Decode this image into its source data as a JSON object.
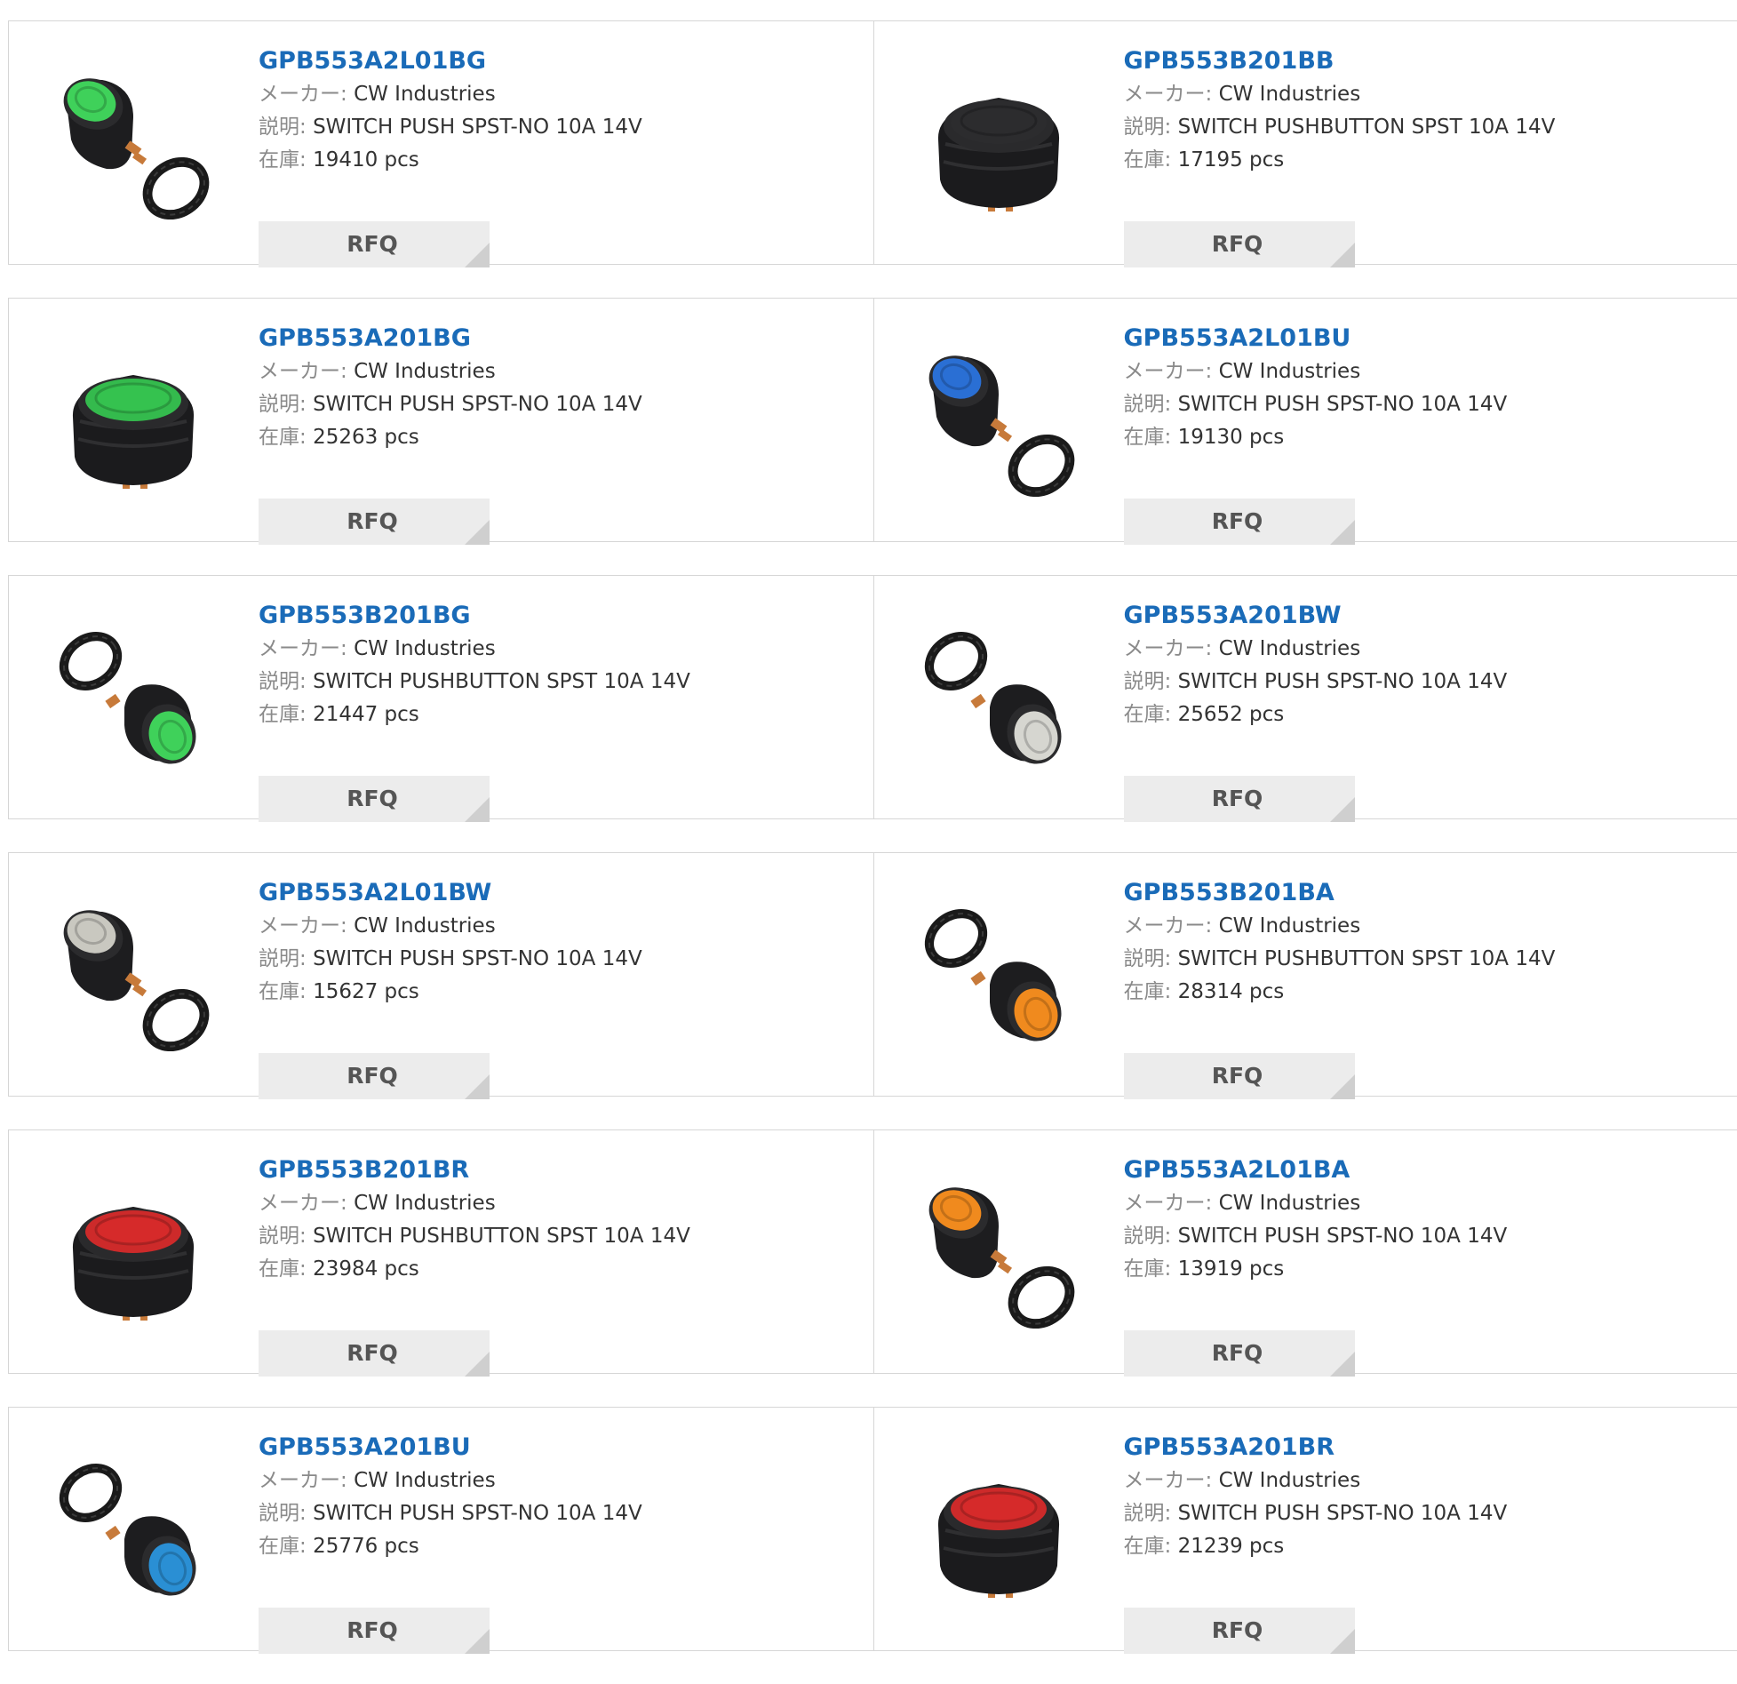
{
  "labels": {
    "maker": "メーカー:",
    "desc": "説明:",
    "stock": "在庫:",
    "rfq": "RFQ"
  },
  "colors": {
    "link": "#1a6bb8",
    "button_bg": "#ececec",
    "border": "#d6d6d6"
  },
  "products": [
    {
      "pn": "GPB553A2L01BG",
      "maker": "CW Industries",
      "desc": "SWITCH PUSH SPST-NO 10A 14V",
      "stock": "19410 pcs",
      "image": {
        "kind": "with-nut",
        "cap": "#3fd15a"
      }
    },
    {
      "pn": "GPB553B201BB",
      "maker": "CW Industries",
      "desc": "SWITCH PUSHBUTTON SPST 10A 14V",
      "stock": "17195 pcs",
      "image": {
        "kind": "large",
        "cap": "#2c2c2e"
      }
    },
    {
      "pn": "GPB553A201BG",
      "maker": "CW Industries",
      "desc": "SWITCH PUSH SPST-NO 10A 14V",
      "stock": "25263 pcs",
      "image": {
        "kind": "large",
        "cap": "#35c24f"
      }
    },
    {
      "pn": "GPB553A2L01BU",
      "maker": "CW Industries",
      "desc": "SWITCH PUSH SPST-NO 10A 14V",
      "stock": "19130 pcs",
      "image": {
        "kind": "with-nut",
        "cap": "#2a6fd4"
      }
    },
    {
      "pn": "GPB553B201BG",
      "maker": "CW Industries",
      "desc": "SWITCH PUSHBUTTON SPST 10A 14V",
      "stock": "21447 pcs",
      "image": {
        "kind": "nut-first",
        "cap": "#3fd15a"
      }
    },
    {
      "pn": "GPB553A201BW",
      "maker": "CW Industries",
      "desc": "SWITCH PUSH SPST-NO 10A 14V",
      "stock": "25652 pcs",
      "image": {
        "kind": "nut-first",
        "cap": "#d6d6d0"
      }
    },
    {
      "pn": "GPB553A2L01BW",
      "maker": "CW Industries",
      "desc": "SWITCH PUSH SPST-NO 10A 14V",
      "stock": "15627 pcs",
      "image": {
        "kind": "with-nut",
        "cap": "#c9c8c0"
      }
    },
    {
      "pn": "GPB553B201BA",
      "maker": "CW Industries",
      "desc": "SWITCH PUSHBUTTON SPST 10A 14V",
      "stock": "28314 pcs",
      "image": {
        "kind": "nut-first",
        "cap": "#f08a1e"
      }
    },
    {
      "pn": "GPB553B201BR",
      "maker": "CW Industries",
      "desc": "SWITCH PUSHBUTTON SPST 10A 14V",
      "stock": "23984 pcs",
      "image": {
        "kind": "large",
        "cap": "#d62a2a"
      }
    },
    {
      "pn": "GPB553A2L01BA",
      "maker": "CW Industries",
      "desc": "SWITCH PUSH SPST-NO 10A 14V",
      "stock": "13919 pcs",
      "image": {
        "kind": "with-nut",
        "cap": "#f08a1e"
      }
    },
    {
      "pn": "GPB553A201BU",
      "maker": "CW Industries",
      "desc": "SWITCH PUSH SPST-NO 10A 14V",
      "stock": "25776 pcs",
      "image": {
        "kind": "nut-first",
        "cap": "#2a8fd4"
      }
    },
    {
      "pn": "GPB553A201BR",
      "maker": "CW Industries",
      "desc": "SWITCH PUSH SPST-NO 10A 14V",
      "stock": "21239 pcs",
      "image": {
        "kind": "large",
        "cap": "#d62a2a"
      }
    }
  ]
}
